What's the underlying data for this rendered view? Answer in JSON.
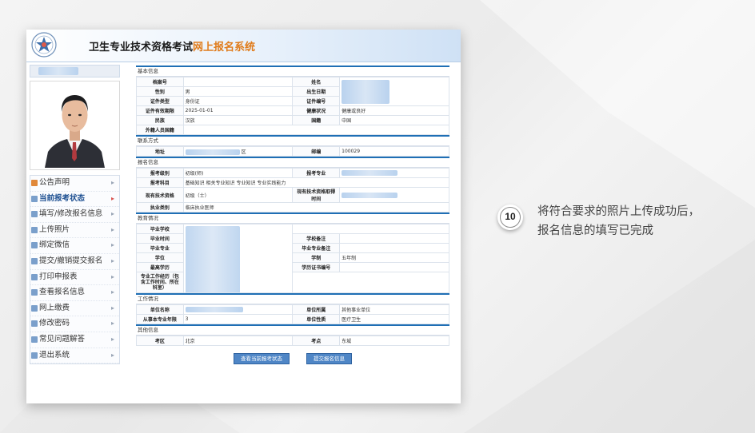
{
  "system_title": {
    "main": "卫生专业技术资格考试",
    "highlight": "网上报名系统"
  },
  "menu": [
    {
      "label": "公告声明",
      "icon": "house-icon",
      "active": false
    },
    {
      "label": "当前报考状态",
      "icon": "status-icon",
      "active": true
    },
    {
      "label": "填写/修改报名信息",
      "icon": "edit-icon",
      "active": false
    },
    {
      "label": "上传照片",
      "icon": "photo-icon",
      "active": false
    },
    {
      "label": "绑定微信",
      "icon": "wechat-icon",
      "active": false
    },
    {
      "label": "提交/撤销提交报名",
      "icon": "submit-icon",
      "active": false
    },
    {
      "label": "打印申报表",
      "icon": "print-icon",
      "active": false
    },
    {
      "label": "查看报名信息",
      "icon": "view-icon",
      "active": false
    },
    {
      "label": "网上缴费",
      "icon": "pay-icon",
      "active": false
    },
    {
      "label": "修改密码",
      "icon": "password-icon",
      "active": false
    },
    {
      "label": "常见问题解答",
      "icon": "faq-icon",
      "active": false
    },
    {
      "label": "退出系统",
      "icon": "logout-icon",
      "active": false
    }
  ],
  "sections": {
    "basic": "基本信息",
    "contact": "联系方式",
    "apply": "报名信息",
    "edu": "教育情况",
    "work": "工作情况",
    "other": "其他信息"
  },
  "basic": {
    "archive_no_label": "档案号",
    "archive_no": "",
    "name_label": "姓名",
    "gender_label": "性别",
    "gender": "男",
    "birth_label": "出生日期",
    "id_type_label": "证件类型",
    "id_type": "身份证",
    "id_no_label": "证件编号",
    "id_expiry_label": "证件有效期限",
    "id_expiry": "2025-01-01",
    "health_label": "健康状况",
    "health": "健康或良好",
    "ethnic_label": "民族",
    "ethnic": "汉族",
    "nation_label": "国籍",
    "nation": "中国",
    "foreign_label": "外籍人员国籍",
    "foreign": ""
  },
  "contact": {
    "address_label": "地址",
    "address_suffix": "区",
    "postcode_label": "邮编",
    "postcode": "100029"
  },
  "apply": {
    "level_label": "报考级别",
    "level": "初级(师)",
    "major_label": "报考专业",
    "subjects_label": "报考科目",
    "subjects": "基础知识  相关专业知识  专业知识  专业实践能力",
    "cur_title_label": "现有技术资格",
    "cur_title": "初级（士）",
    "cur_title_time_label": "现有技术资格取得时间",
    "practice_label": "执业类别",
    "practice": "临床执业医师"
  },
  "edu": {
    "school_label": "毕业学校",
    "grad_time_label": "毕业时间",
    "school_note_label": "学校备注",
    "grad_major_label": "毕业专业",
    "major_note_label": "毕业专业备注",
    "degree_label": "学位",
    "schooling_label": "学制",
    "schooling": "五年制",
    "highest_label": "最高学历",
    "cert_no_label": "学历证书编号",
    "work_exp_label": "专业工作经历（包含工作时间、所在科室）"
  },
  "work": {
    "unit_name_label": "单位名称",
    "unit_type_label": "单位所属",
    "unit_type": "其他事业单位",
    "years_label": "从事本专业年限",
    "years": "3",
    "unit_nature_label": "单位性质",
    "unit_nature": "医疗卫生"
  },
  "other": {
    "area_label": "考区",
    "area": "北京",
    "site_label": "考点",
    "site": "东城"
  },
  "buttons": {
    "view_status": "查看当前报考状态",
    "submit": "提交报名信息"
  },
  "step": {
    "number": "10",
    "line1": "将符合要求的照片上传成功后，",
    "line2": "报名信息的填写已完成"
  }
}
